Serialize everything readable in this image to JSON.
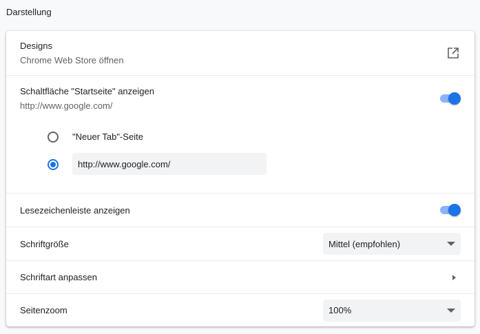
{
  "section_title": "Darstellung",
  "designs": {
    "label": "Designs",
    "sublabel": "Chrome Web Store öffnen",
    "icon": "open-in-new-icon"
  },
  "home_button": {
    "label": "Schaltfläche \"Startseite\" anzeigen",
    "sublabel": "http://www.google.com/",
    "enabled": true,
    "options": [
      {
        "label": "\"Neuer Tab\"-Seite",
        "selected": false
      },
      {
        "value": "http://www.google.com/",
        "selected": true
      }
    ]
  },
  "bookmarks_bar": {
    "label": "Lesezeichenleiste anzeigen",
    "enabled": true
  },
  "font_size": {
    "label": "Schriftgröße",
    "value": "Mittel (empfohlen)"
  },
  "customize_fonts": {
    "label": "Schriftart anpassen"
  },
  "page_zoom": {
    "label": "Seitenzoom",
    "value": "100%"
  },
  "colors": {
    "accent": "#1a73e8",
    "toggle_track": "#8ab4f8"
  }
}
